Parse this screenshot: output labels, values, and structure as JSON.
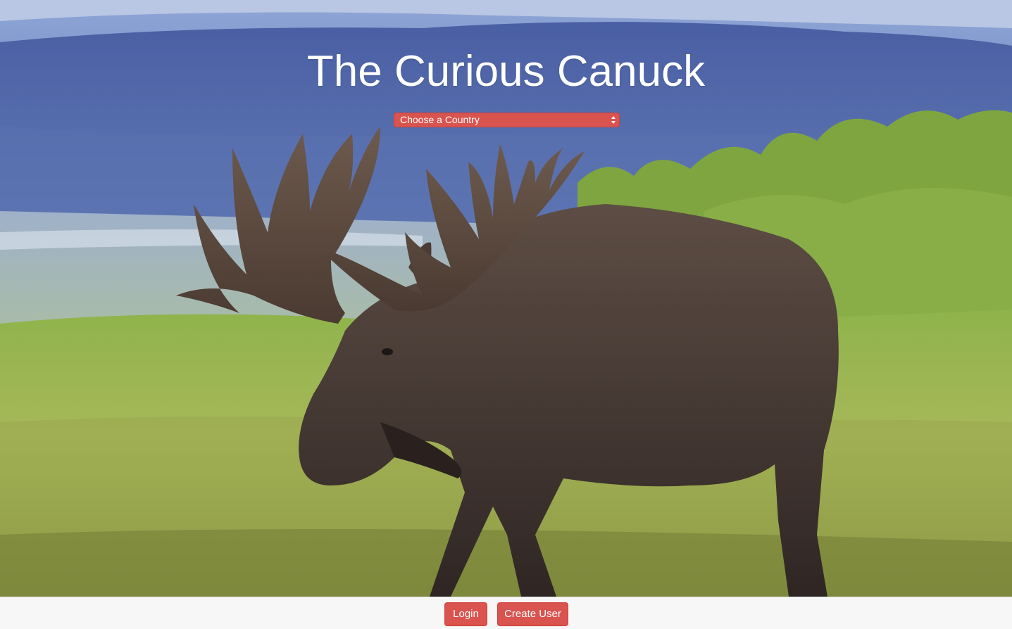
{
  "header": {
    "title": "The Curious Canuck"
  },
  "country_select": {
    "selected": "Choose a Country"
  },
  "footer": {
    "login_label": "Login",
    "create_user_label": "Create User"
  },
  "hero": {
    "image_subject": "moose-in-meadow"
  },
  "colors": {
    "accent": "#d9534f",
    "footer_bg": "#f7f7f7",
    "title": "#ffffff"
  }
}
